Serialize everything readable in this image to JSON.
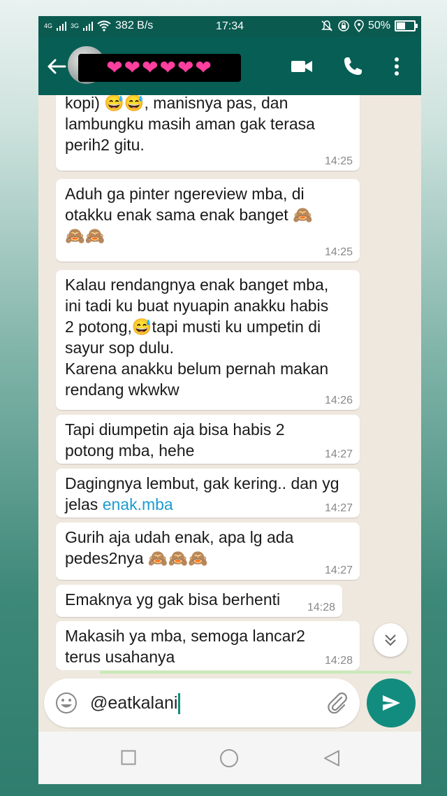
{
  "status_bar": {
    "network_1": "4G",
    "network_2": "3G",
    "speed": "382 B/s",
    "time": "17:34",
    "battery": "50%",
    "battery_level": 0.5
  },
  "header": {
    "contact_name_redacted": "❤❤❤❤❤❤",
    "icons": [
      "back-arrow-icon",
      "avatar",
      "video-call-icon",
      "phone-icon",
      "more-vert-icon"
    ]
  },
  "messages": [
    {
      "text": "kopi) 😅😅, manisnya pas, dan\nlambungku masih aman gak terasa\nperih2 gitu.",
      "time": "14:25"
    },
    {
      "text": "Aduh ga pinter ngereview mba, di\notakku enak sama enak banget 🙈\n🙈🙈",
      "time": "14:25"
    },
    {
      "text": "Kalau rendangnya enak banget mba,\nini tadi ku buat nyuapin anakku habis\n2 potong,😅tapi musti ku umpetin di\nsayur sop dulu.\nKarena anakku belum pernah makan\nrendang wkwkw",
      "time": "14:26"
    },
    {
      "text": "Tapi diumpetin aja bisa habis 2\npotong mba, hehe",
      "time": "14:27"
    },
    {
      "text_before_link": "Dagingnya lembut, gak kering.. dan yg\njelas ",
      "link": "enak.mba",
      "time": "14:27"
    },
    {
      "text": "Gurih aja udah enak, apa lg ada\npedes2nya 🙈🙈🙈",
      "time": "14:27"
    },
    {
      "text": "Emaknya yg gak bisa berhenti",
      "time": "14:28"
    },
    {
      "text": "Makasih ya mba, semoga lancar2\nterus usahanya",
      "time": "14:28"
    }
  ],
  "composer": {
    "value": "@eatkalani"
  },
  "colors": {
    "header": "#075e54",
    "statusbar": "#0b5a50",
    "send": "#128c7e",
    "link": "#1d9bd1"
  }
}
